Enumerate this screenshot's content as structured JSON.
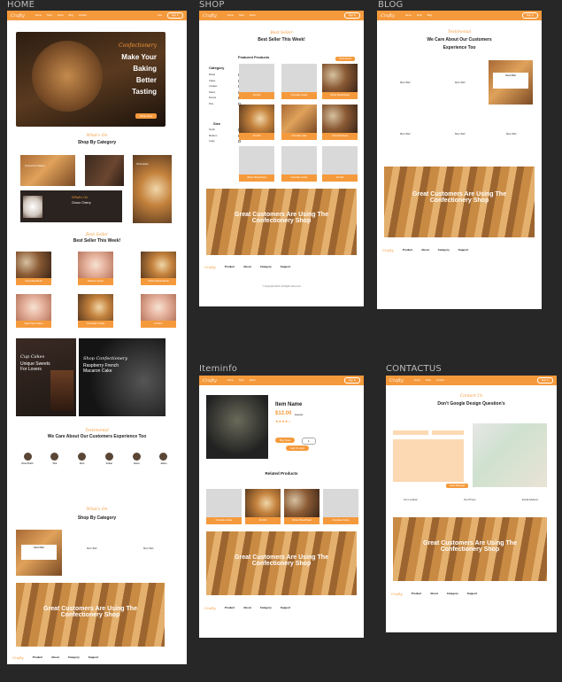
{
  "labels": {
    "home": "HOME",
    "shop": "SHOP",
    "blog": "BLOG",
    "iteminfo": "Iteminfo",
    "contactus": "CONTACTUS"
  },
  "colors": {
    "accent": "#f59a3c",
    "bg": "#272727"
  },
  "nav": {
    "logo": "Crafty",
    "links": [
      "Home",
      "Shop",
      "About",
      "Blog",
      "Contact"
    ],
    "cart": "Cart",
    "signin": "Sign In"
  },
  "home": {
    "hero_script": "Confectionery",
    "hero_l1": "Make Your",
    "hero_l2": "Baking",
    "hero_l3": "Better",
    "hero_l4": "Tasting",
    "hero_btn": "Shop Now",
    "cat_script": "What's On",
    "cat_title": "Shop By Category",
    "cats": [
      "Cinnamon Pastry",
      "Macarons",
      "Chocolate",
      "Choco Cherry"
    ],
    "best_script": "Best Seller",
    "best_title": "Best Seller This Week!",
    "best_items": [
      "Chocolate Bundt",
      "Macaron Drops",
      "Whole Wheat Bread",
      "Cake Pops Variety",
      "Chocolate Cookie",
      "Lil Macs"
    ],
    "promo1_script": "Cup Cakes",
    "promo1_text": "Unique Sweets For Lovers",
    "promo2_script": "Shop Confectionery",
    "promo2_text": "Raspberry French Macaron Cake",
    "test_script": "Testimonial",
    "test_title": "We Care About Our Customers Experience Too",
    "test_names": [
      "Elisa Smith",
      "Tina",
      "Alice",
      "Amber",
      "Alena",
      "James"
    ],
    "blog_script": "What's On",
    "blog_title": "Shop By Category",
    "blog_items": [
      "Merci Bell",
      "Merci Bell",
      "Merci Bell"
    ],
    "banner": "Great Customers Are Using The Confectionery Shop",
    "footer": [
      "Product",
      "About",
      "Category",
      "Support"
    ]
  },
  "shop": {
    "best_script": "Best Seller",
    "best_title": "Best Seller This Week!",
    "featured": "Featured Products",
    "all_products": "All Products",
    "category": "Category",
    "cat_items": [
      "Bread",
      "Cakes",
      "Cookies",
      "Pastry",
      "Donuts",
      "Pies"
    ],
    "size": "Size",
    "sizes": [
      "Small",
      "Medium",
      "Large"
    ],
    "products": [
      "Nut Roll",
      "Chocolate Cookie",
      "Whole Wheat Bread",
      "Nut Roll",
      "Chocolate Cake",
      "Chocolate Bread",
      "Whole Wheat Bread",
      "Chocolate Cookie",
      "Nut Roll"
    ],
    "banner": "Great Customers Are Using The Confectionery Shop",
    "copyright": "© Copyright 2023 | All Rights Reserved"
  },
  "blog": {
    "script": "Testimonial",
    "title": "We Care About Our Customers Experience Too",
    "items": [
      "Merci Bell",
      "Merci Bell",
      "Merci Bell",
      "Merci Bell",
      "Merci Bell",
      "Merci Bell"
    ],
    "banner": "Great Customers Are Using The Confectionery Shop"
  },
  "item": {
    "name": "Item Name",
    "price": "$12.00",
    "old_price": "$14.00",
    "add_btn": "Buy Now",
    "cart_btn": "Add To Cart",
    "qty": "1",
    "related": "Related Products",
    "related_items": [
      "Chocolate Cookie",
      "Nut Roll",
      "Whole Wheat Bread",
      "Chocolate Cookie"
    ],
    "banner": "Great Customers Are Using The Confectionery Shop"
  },
  "contact": {
    "script": "Contact Us",
    "title": "Don't Google Design Question's",
    "send": "Send Message",
    "info": [
      "Our Location",
      "Our Phone",
      "Email Address"
    ],
    "banner": "Great Customers Are Using The Confectionery Shop"
  }
}
